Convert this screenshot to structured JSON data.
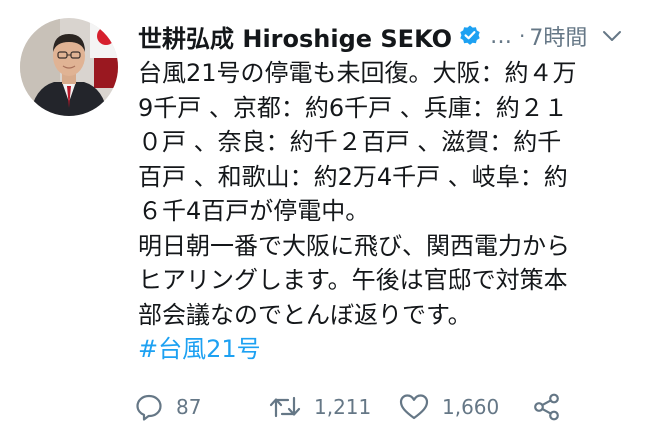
{
  "tweet": {
    "author": {
      "display_name": "世耕弘成 Hiroshige SEKO",
      "verified_icon": "verified-badge-icon",
      "avatar": "avatar-photo"
    },
    "ellipsis": "…",
    "separator": "·",
    "timestamp": "7時間",
    "menu_icon": "chevron-down-icon",
    "lines": [
      "台風21号の停電も未回復。大阪：約４万",
      "9千戸 、京都：約6千戸 、兵庫：約２１",
      "０戸 、奈良：約千２百戸 、滋賀：約千",
      "百戸 、和歌山：約2万4千戸 、岐阜：約",
      "６千4百戸が停電中。",
      "明日朝一番で大阪に飛び、関西電力から",
      "ヒアリングします。午後は官邸で対策本",
      "部会議なのでとんぼ返りです。"
    ],
    "hashtag": "#台風21号",
    "actions": {
      "reply": {
        "icon": "reply-icon",
        "count": "87"
      },
      "retweet": {
        "icon": "retweet-icon",
        "count": "1,211"
      },
      "like": {
        "icon": "heart-icon",
        "count": "1,660"
      },
      "share": {
        "icon": "share-icon"
      }
    },
    "colors": {
      "text": "#14171a",
      "secondary": "#657786",
      "link": "#1da1f2",
      "verified": "#1da1f2"
    }
  }
}
